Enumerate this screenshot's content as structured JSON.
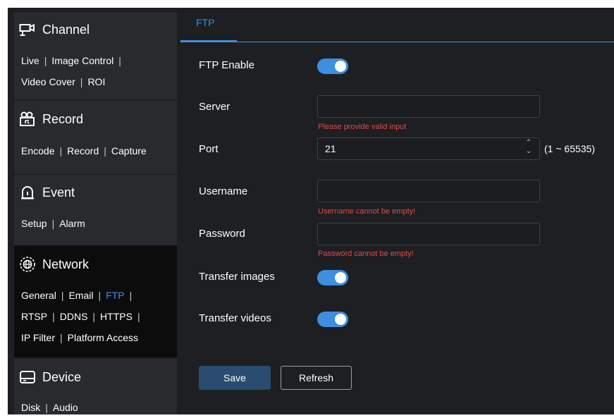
{
  "sidebar": {
    "channel": {
      "title": "Channel",
      "icon": "camera-icon",
      "row1": [
        "Live",
        "Image Control"
      ],
      "row2": [
        "Video Cover",
        "ROI"
      ]
    },
    "record": {
      "title": "Record",
      "icon": "recorder-icon",
      "row1": [
        "Encode",
        "Record",
        "Capture"
      ]
    },
    "event": {
      "title": "Event",
      "icon": "alarm-icon",
      "row1": [
        "Setup",
        "Alarm"
      ]
    },
    "network": {
      "title": "Network",
      "icon": "network-globe-icon",
      "row1": [
        "General",
        "Email",
        "FTP"
      ],
      "row2": [
        "RTSP",
        "DDNS",
        "HTTPS"
      ],
      "row3": [
        "IP Filter",
        "Platform Access"
      ],
      "selected_link": "FTP"
    },
    "device": {
      "title": "Device",
      "icon": "hard-disk-icon",
      "row1": [
        "Disk",
        "Audio"
      ]
    },
    "separator": "|"
  },
  "main": {
    "tab": "FTP",
    "form": {
      "ftp_enable": {
        "label": "FTP Enable",
        "on": true
      },
      "server": {
        "label": "Server",
        "value": "",
        "error": "Please provide valid input"
      },
      "port": {
        "label": "Port",
        "value": "21",
        "range": "(1 ~ 65535)",
        "up": "⌃",
        "down": "⌄"
      },
      "username": {
        "label": "Username",
        "value": "",
        "error": "Username cannot be empty!"
      },
      "password": {
        "label": "Password",
        "value": "",
        "error": "Password cannot be empty!"
      },
      "transfer_images": {
        "label": "Transfer images",
        "on": true
      },
      "transfer_videos": {
        "label": "Transfer videos",
        "on": true
      }
    },
    "buttons": {
      "save": "Save",
      "refresh": "Refresh"
    }
  },
  "colors": {
    "accent": "#3d8fe0",
    "error": "#e24a4a",
    "toggle_on": "#3e8fe0",
    "save_button": "#2a4c70"
  }
}
